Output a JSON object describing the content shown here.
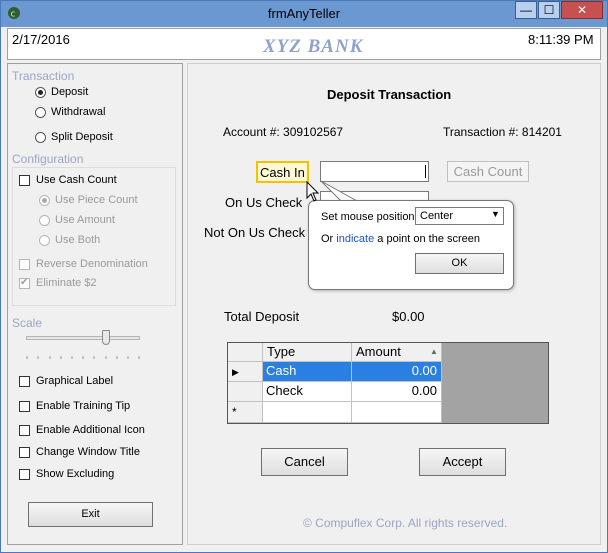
{
  "window": {
    "title": "frmAnyTeller",
    "min_glyph": "—",
    "max_glyph": "☐",
    "close_glyph": "✕"
  },
  "header": {
    "date": "2/17/2016",
    "bank_name": "XYZ BANK",
    "time": "8:11:39 PM"
  },
  "sidebar": {
    "transaction_title": "Transaction",
    "transaction_options": [
      "Deposit",
      "Withdrawal",
      "Split Deposit"
    ],
    "transaction_selected": "Deposit",
    "configuration_title": "Configuration",
    "use_cash_count": "Use Cash Count",
    "cash_count_options": [
      "Use Piece Count",
      "Use Amount",
      "Use Both"
    ],
    "reverse_denomination": "Reverse Denomination",
    "eliminate_2": "Eliminate $2",
    "scale_title": "Scale",
    "scale_value": 0.7,
    "options": [
      "Graphical Label",
      "Enable Training Tip",
      "Enable Additional Icon",
      "Change Window Title",
      "Show Excluding"
    ],
    "exit_label": "Exit"
  },
  "main": {
    "heading": "Deposit Transaction",
    "account_label": "Account #: 309102567",
    "transaction_label": "Transaction #: 814201",
    "cash_in_label": "Cash In",
    "cash_count_button": "Cash Count",
    "on_us_check_label": "On Us Check",
    "not_on_us_check_label": "Not On Us Check",
    "total_deposit_label": "Total Deposit",
    "total_deposit_value": "$0.00",
    "grid": {
      "headers": [
        "Type",
        "Amount"
      ],
      "sort_glyph": "▲",
      "current_row_glyph": "▶",
      "new_row_glyph": "*",
      "rows": [
        {
          "type": "Cash",
          "amount": "0.00"
        },
        {
          "type": "Check",
          "amount": "0.00"
        }
      ]
    },
    "cancel_label": "Cancel",
    "accept_label": "Accept",
    "copyright": "© Compuflex Corp. All rights reserved."
  },
  "popup": {
    "position_label": "Set mouse position",
    "position_value": "Center",
    "or_text": "Or",
    "indicate_link": "indicate",
    "rest_text": "a point on the screen",
    "ok_label": "OK"
  }
}
